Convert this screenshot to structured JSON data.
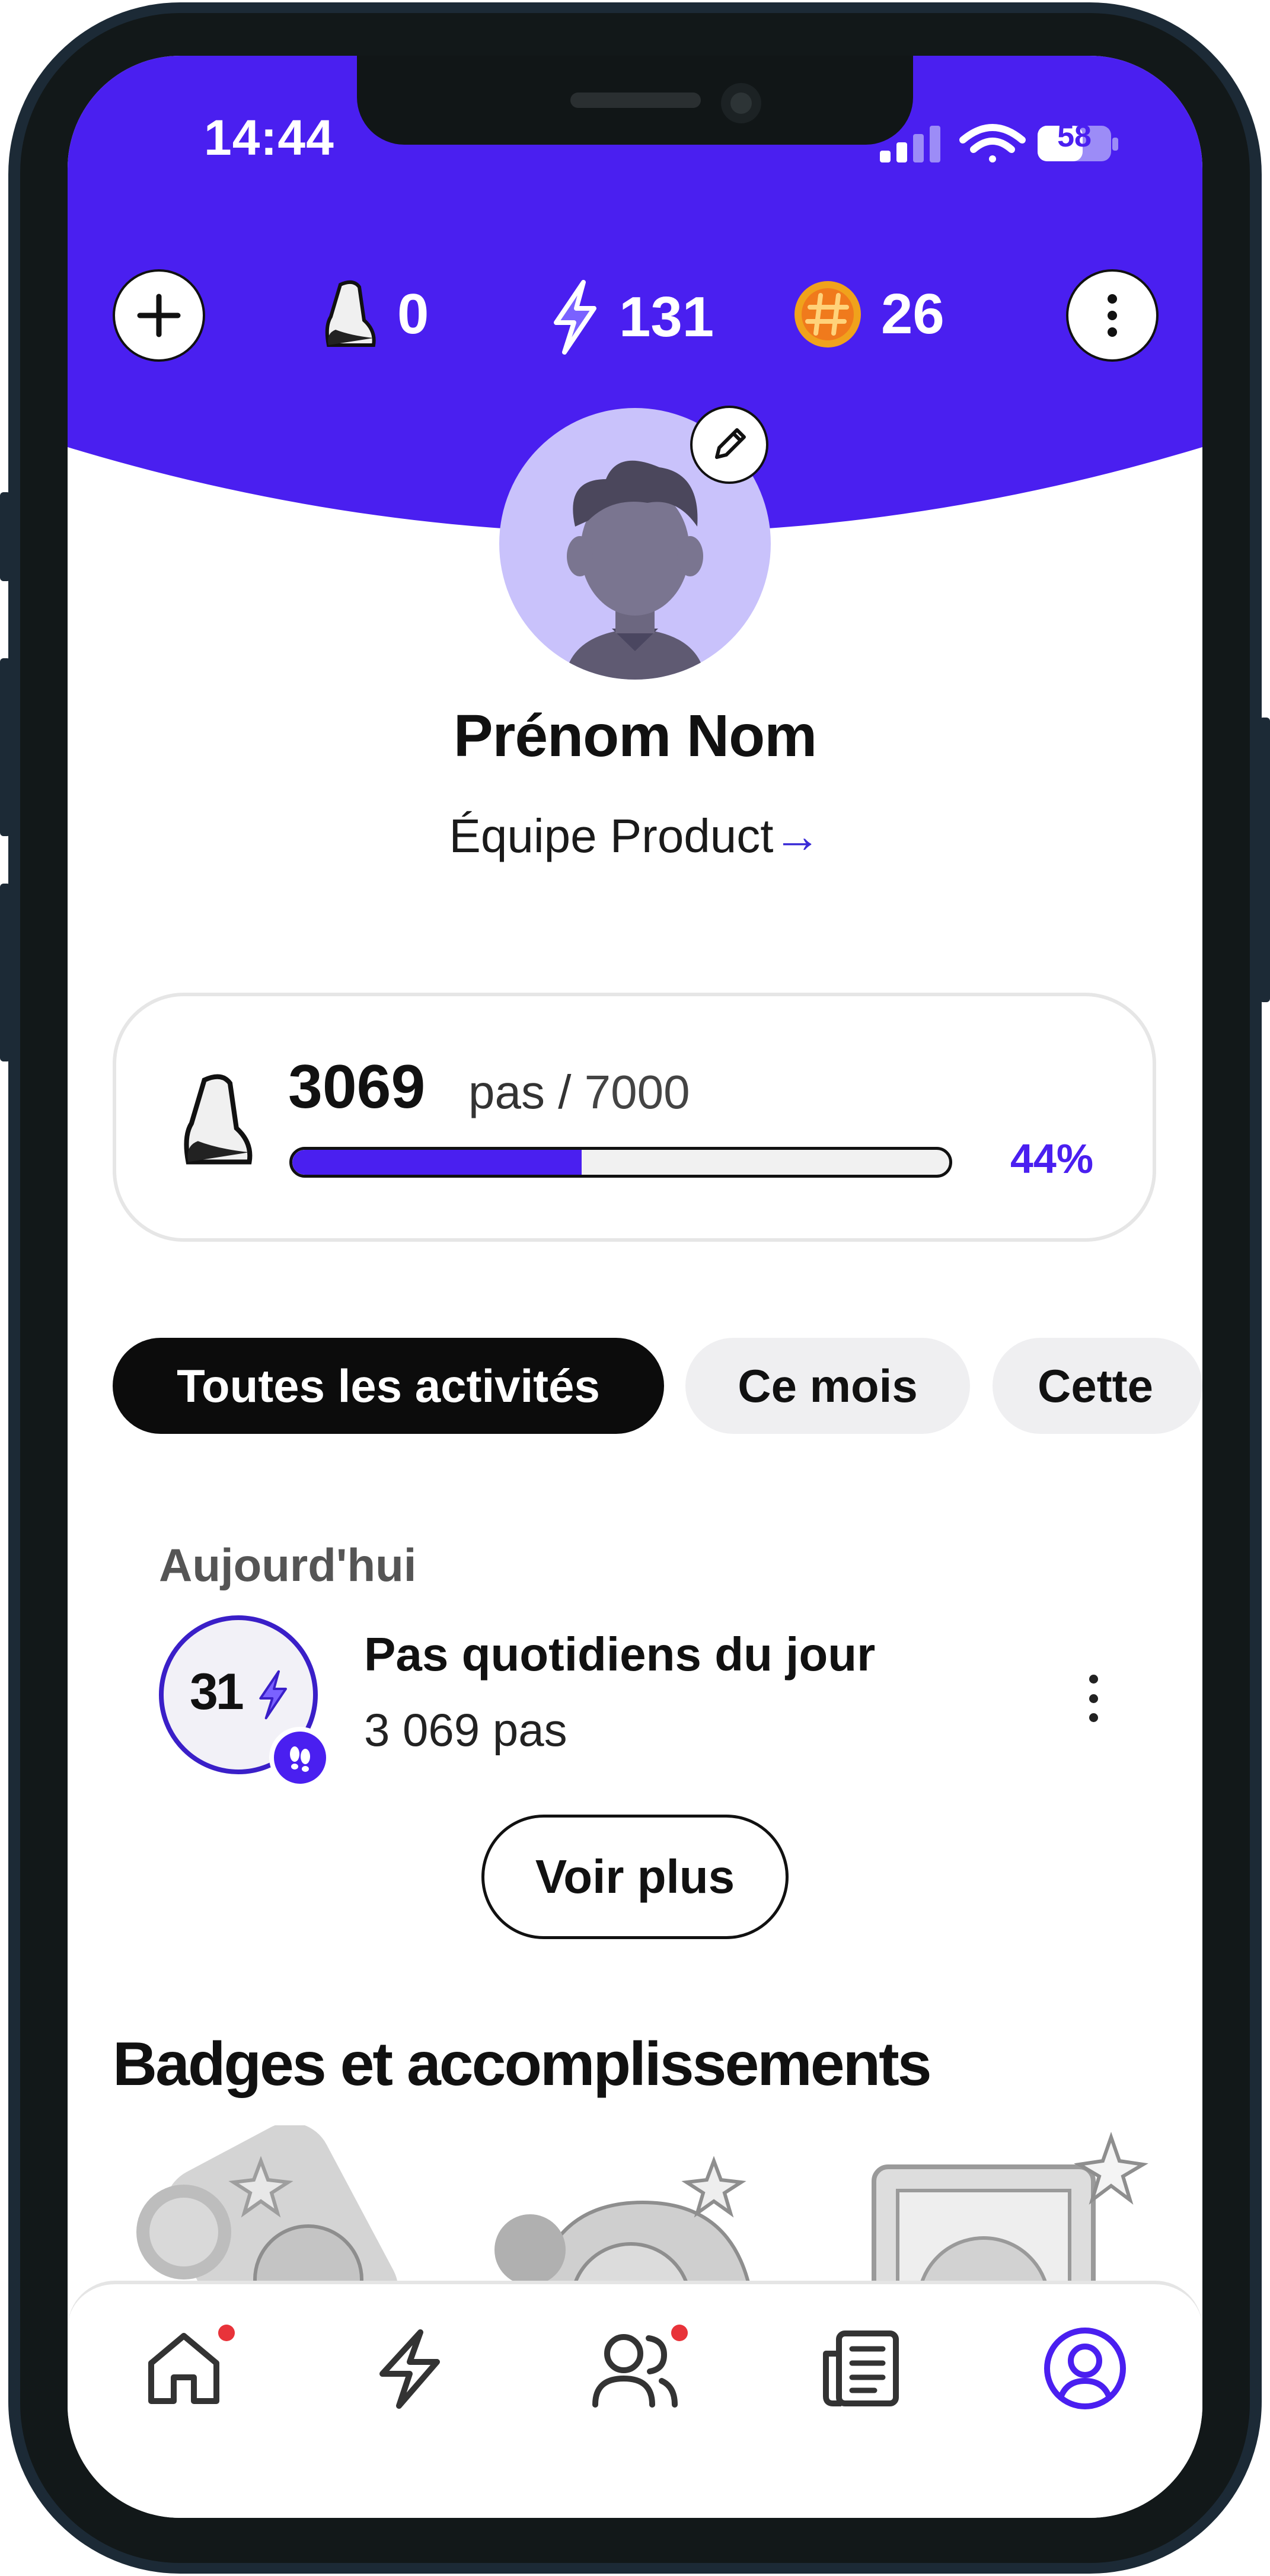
{
  "status_bar": {
    "time": "14:44",
    "battery": "58"
  },
  "top_bar": {
    "add_button": "+",
    "steps_stat": "0",
    "energy_stat": "131",
    "coins_stat": "26"
  },
  "profile": {
    "name": "Prénom Nom",
    "team": "Équipe Product",
    "team_arrow": "→"
  },
  "steps_card": {
    "count": "3069",
    "unit_label": "pas /",
    "goal": "7000",
    "progress_fraction": 0.44,
    "progress_label": "44%"
  },
  "filters": {
    "all": "Toutes les activités",
    "month": "Ce mois",
    "third": "Cette"
  },
  "activities": {
    "section_label": "Aujourd'hui",
    "items": [
      {
        "points": "31",
        "title": "Pas quotidiens du jour",
        "subtitle": "3 069 pas"
      }
    ],
    "see_more": "Voir plus"
  },
  "badges": {
    "title": "Badges et accomplissements"
  },
  "bottom_nav": {
    "items": [
      "home-icon",
      "activity-icon",
      "team-icon",
      "news-icon",
      "profile-icon"
    ],
    "active": "profile-icon",
    "notification_dots": [
      "home-icon",
      "team-icon"
    ]
  },
  "colors": {
    "brand": "#4a1ff0",
    "header": "#4a1ff0",
    "notification": "#e8333a"
  }
}
